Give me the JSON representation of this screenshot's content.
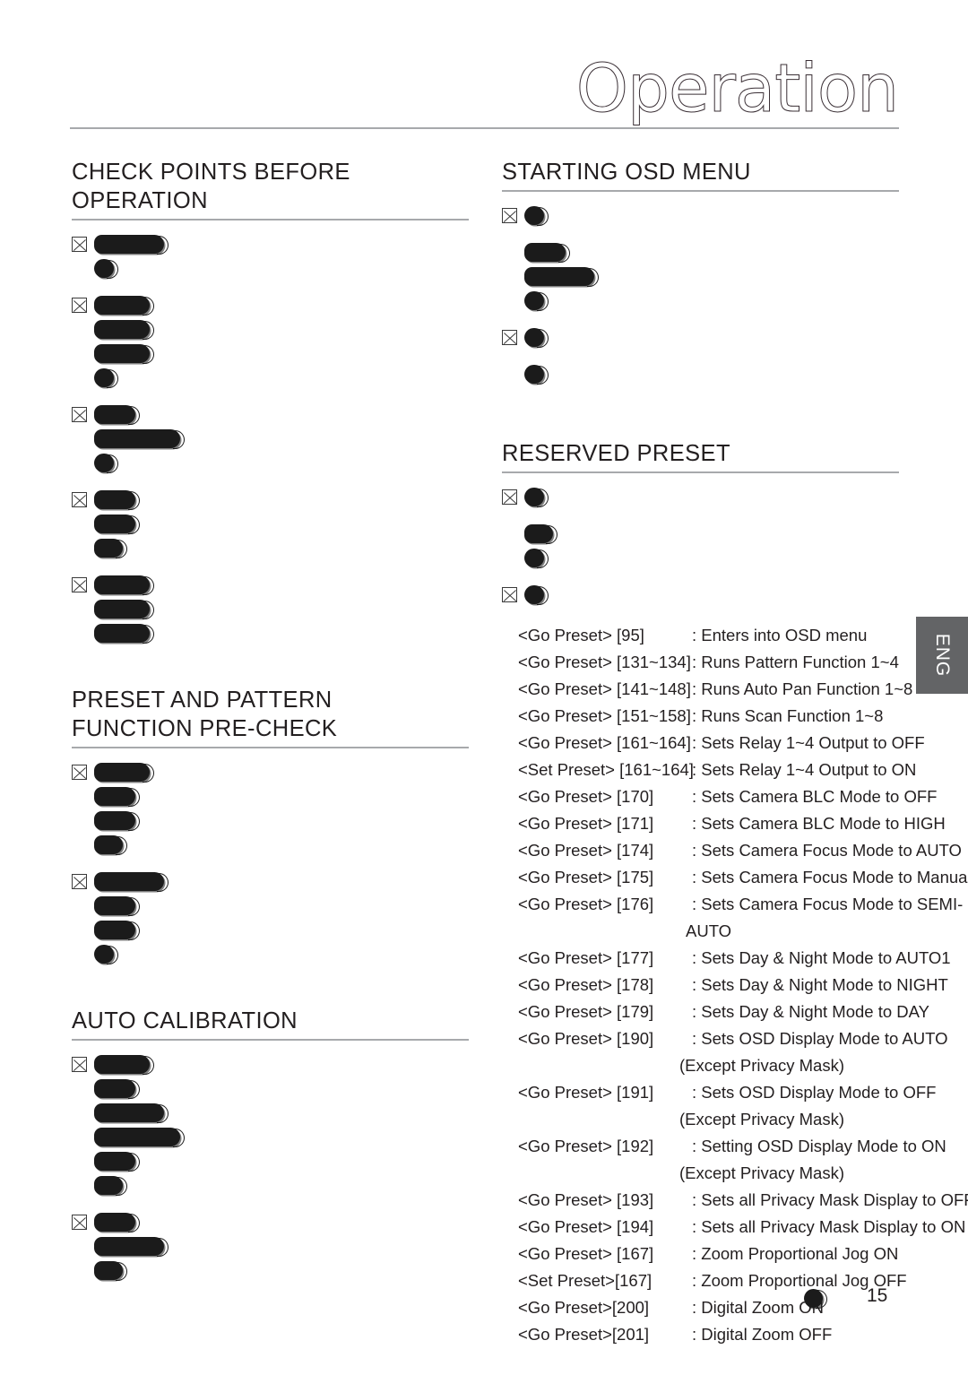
{
  "header": {
    "title": "Operation"
  },
  "side_tab": {
    "label": "ENG"
  },
  "footer": {
    "page_number": "15",
    "mark_icon": "redacted-blob-icon"
  },
  "left_column": {
    "sections": [
      {
        "heading": "CHECK POINTS BEFORE\nOPERATION",
        "bullet_groups": [
          {
            "marker": "crossed-box-marker",
            "lines": [
              "l",
              "tiny"
            ]
          },
          {
            "marker": "crossed-box-marker",
            "lines": [
              "m",
              "m",
              "m",
              "tiny"
            ]
          },
          {
            "marker": "crossed-box-marker",
            "lines": [
              "s",
              "xl",
              "tiny"
            ]
          },
          {
            "marker": "crossed-box-marker",
            "lines": [
              "s",
              "s",
              "xs"
            ]
          },
          {
            "marker": "crossed-box-marker",
            "lines": [
              "m",
              "m",
              "m"
            ]
          }
        ]
      },
      {
        "heading": "PRESET AND PATTERN\nFUNCTION PRE-CHECK",
        "bullet_groups": [
          {
            "marker": "crossed-box-marker",
            "lines": [
              "m",
              "s",
              "s",
              "xs"
            ]
          },
          {
            "marker": "crossed-box-marker",
            "lines": [
              "l",
              "s",
              "s",
              "tiny"
            ]
          }
        ]
      },
      {
        "heading": "AUTO CALIBRATION",
        "bullet_groups": [
          {
            "marker": "crossed-box-marker",
            "lines": [
              "m",
              "s",
              "l",
              "xl",
              "s",
              "xs"
            ]
          },
          {
            "marker": "crossed-box-marker",
            "lines": [
              "s",
              "l",
              "xs"
            ]
          }
        ]
      }
    ]
  },
  "right_column": {
    "sections": [
      {
        "heading": "STARTING OSD MENU",
        "bullet_groups": [
          {
            "marker": "crossed-box-marker",
            "lines": [
              "tiny"
            ]
          },
          {
            "marker": "none",
            "lines": [
              "s",
              "l",
              "tiny"
            ]
          },
          {
            "marker": "crossed-box-marker",
            "lines": [
              "tiny"
            ]
          },
          {
            "marker": "none",
            "lines": [
              "tiny"
            ]
          }
        ]
      },
      {
        "heading": "RESERVED PRESET",
        "bullet_groups": [
          {
            "marker": "crossed-box-marker",
            "lines": [
              "tiny"
            ]
          },
          {
            "marker": "none",
            "lines": [
              "xs",
              "tiny"
            ]
          },
          {
            "marker": "crossed-box-marker",
            "lines": [
              "tiny"
            ]
          }
        ]
      }
    ],
    "preset_list": [
      {
        "command": "<Go Preset> [95]",
        "description": ": Enters into OSD menu"
      },
      {
        "command": "<Go Preset> [131~134]",
        "description": ": Runs Pattern Function 1~4"
      },
      {
        "command": "<Go Preset> [141~148]",
        "description": ": Runs Auto Pan Function 1~8"
      },
      {
        "command": "<Go Preset> [151~158]",
        "description": ": Runs Scan Function 1~8"
      },
      {
        "command": "<Go Preset> [161~164]",
        "description": ": Sets Relay 1~4 Output to OFF"
      },
      {
        "command": "<Set Preset> [161~164]",
        "description": ": Sets Relay 1~4 Output to ON"
      },
      {
        "command": "<Go Preset> [170]",
        "description": ": Sets Camera BLC Mode to OFF"
      },
      {
        "command": "<Go Preset> [171]",
        "description": ": Sets Camera BLC Mode to HIGH"
      },
      {
        "command": "<Go Preset> [174]",
        "description": ": Sets Camera Focus Mode to AUTO"
      },
      {
        "command": "<Go Preset> [175]",
        "description": ": Sets Camera Focus Mode to Manual"
      },
      {
        "command": "<Go Preset> [176]",
        "description": ": Sets Camera Focus Mode to SEMI-",
        "continuation": "AUTO"
      },
      {
        "command": "<Go Preset> [177]",
        "description": ": Sets Day & Night Mode to AUTO1"
      },
      {
        "command": "<Go Preset> [178]",
        "description": ": Sets Day & Night Mode to NIGHT"
      },
      {
        "command": "<Go Preset> [179]",
        "description": ": Sets Day & Night Mode to DAY"
      },
      {
        "command": "<Go Preset> [190]",
        "description": ": Sets OSD Display Mode to AUTO",
        "continuation2": "(Except Privacy Mask)"
      },
      {
        "command": "<Go Preset> [191]",
        "description": ": Sets OSD Display Mode to OFF",
        "continuation2": "(Except Privacy Mask)"
      },
      {
        "command": "<Go Preset> [192]",
        "description": ": Setting OSD Display Mode to ON",
        "continuation2": "(Except Privacy Mask)"
      },
      {
        "command": "<Go Preset> [193]",
        "description": ": Sets all Privacy Mask Display to OFF"
      },
      {
        "command": "<Go Preset> [194]",
        "description": ": Sets all Privacy Mask Display to ON"
      },
      {
        "command": "<Go Preset> [167]",
        "description": ": Zoom Proportional Jog ON"
      },
      {
        "command": "<Set Preset>[167]",
        "description": ": Zoom Proportional Jog OFF"
      },
      {
        "command": "<Go Preset>[200]",
        "description": ": Digital Zoom ON"
      },
      {
        "command": "<Go Preset>[201]",
        "description": ": Digital Zoom OFF"
      }
    ]
  }
}
